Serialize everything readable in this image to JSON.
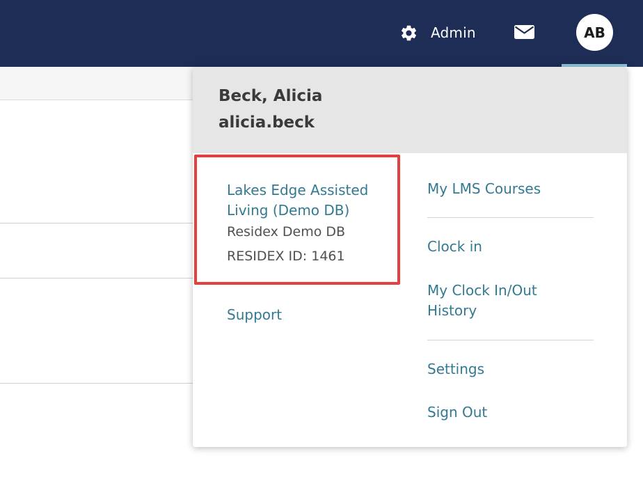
{
  "topbar": {
    "admin_label": "Admin",
    "admin_icon": "gear-icon",
    "mail_icon": "envelope-icon",
    "avatar_initials": "AB",
    "background_color": "#1e2d55",
    "active_indicator_color": "#8ec3d6"
  },
  "user_menu": {
    "header": {
      "full_name": "Beck, Alicia",
      "username": "alicia.beck"
    },
    "facility": {
      "name": "Lakes Edge Assisted Living (Demo DB)",
      "database": "Residex Demo DB",
      "id_text": "RESIDEX ID: 1461"
    },
    "support_label": "Support",
    "items": {
      "lms_courses": "My LMS Courses",
      "clock_in": "Clock in",
      "clock_history": "My Clock In/Out History",
      "settings": "Settings",
      "sign_out": "Sign Out"
    },
    "link_color": "#327a92",
    "highlight_color": "#e5403e"
  }
}
